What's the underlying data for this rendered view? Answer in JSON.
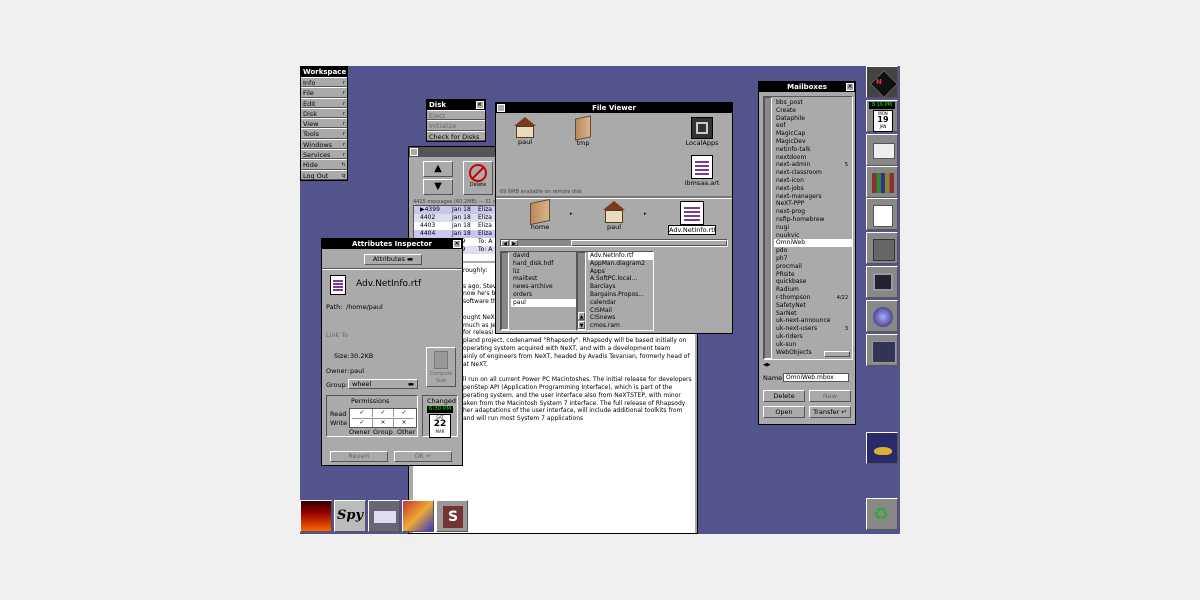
{
  "workspace_menu": {
    "title": "Workspace",
    "items": [
      {
        "label": "Info",
        "key": "r"
      },
      {
        "label": "File",
        "key": "r"
      },
      {
        "label": "Edit",
        "key": "r"
      },
      {
        "label": "Disk",
        "key": "r"
      },
      {
        "label": "View",
        "key": "r"
      },
      {
        "label": "Tools",
        "key": "r"
      },
      {
        "label": "Windows",
        "key": "r"
      },
      {
        "label": "Services",
        "key": "r"
      },
      {
        "label": "Hide",
        "key": "h"
      },
      {
        "label": "Log Out",
        "key": "q"
      }
    ]
  },
  "disk_menu": {
    "title": "Disk",
    "items": [
      {
        "label": "Eject"
      },
      {
        "label": "Initialize"
      },
      {
        "label": "Check for Disks"
      }
    ]
  },
  "file_viewer": {
    "title": "File Viewer",
    "shelf": [
      {
        "label": "paul"
      },
      {
        "label": "tmp"
      },
      {
        "label": "LocalApps"
      },
      {
        "label": "ibmsaa.art"
      }
    ],
    "status": "69.6MB available on remote disk",
    "path": [
      {
        "label": "home"
      },
      {
        "label": "paul"
      },
      {
        "label": "Adv.NetInfo.rtf"
      }
    ],
    "col1": [
      "david",
      "hard_disk.hdf",
      "liz",
      "mailtest",
      "news-archive",
      "orders",
      "paul"
    ],
    "col2": [
      "Adv.NetInfo.rtf",
      "AppMan.diagram2",
      "Apps",
      "A.SoftPC.local...",
      "Barclays",
      "Bargains.Propos...",
      "calendar",
      "CISMail",
      "CISnews",
      "cmos.ram"
    ]
  },
  "mail": {
    "delete_label": "Delete",
    "status": "4415 messages (60.2MB) — 31 d...",
    "rows": [
      {
        "num": "▶4399",
        "date": "Jan 18",
        "from": "Eliza",
        "to": "To: a"
      },
      {
        "num": "4402",
        "date": "Jan 18",
        "from": "Eliza",
        "to": ""
      },
      {
        "num": "4403",
        "date": "Jan 18",
        "from": "Eliza",
        "to": ""
      },
      {
        "num": "4404",
        "date": "Jan 18",
        "from": "Eliza",
        "to": ""
      },
      {
        "num": "",
        "date": "n 19",
        "from": "To: A",
        "to": ""
      },
      {
        "num": "",
        "date": "n 19",
        "from": "To: A",
        "to": ""
      }
    ],
    "body": [
      "roughly:",
      "",
      "s ago, Stev",
      "now he's ba",
      "software th",
      "",
      "ought NeX",
      "much as Je",
      "for releasi",
      "pland project, codenamed \"Rhapsody\". Rhapsody will be based initially on",
      "operating system acquired with NeXT, and with a development team",
      "ainly of engineers from NeXT, headed by Avadis Tevanian, formerly head of",
      "at NeXT.",
      "",
      "ll run on all current Power PC Macintoshes. The initial release for developers",
      "penStep API (Application Programming Interface), which is part of the",
      "perating system, and the user interface also from NeXTSTEP, with minor",
      "aken from the Macintosh System 7 interface. The full release of Rhapsody",
      "her adaptations of the user interface, will include additional toolkits from",
      "and will run most System 7 applications"
    ]
  },
  "inspector": {
    "title": "Attributes Inspector",
    "popup": "Attributes",
    "filename": "Adv.NetInfo.rtf",
    "path_label": "Path:",
    "path_value": "/home/paul",
    "link_label": "Link To",
    "size_label": "Size:",
    "size_value": "30.2KB",
    "owner_label": "Owner:",
    "owner_value": "paul",
    "group_label": "Group:",
    "group_value": "wheel",
    "compute_label": "Compute Size",
    "permissions_label": "Permissions",
    "read_label": "Read",
    "write_label": "Write",
    "cols": [
      "Owner",
      "Group",
      "Other"
    ],
    "changed_label": "Changed",
    "time": "6:30 PM",
    "cal_day": "SAT",
    "cal_date": "22",
    "cal_month": "MAR",
    "revert_label": "Revert",
    "ok_label": "OK"
  },
  "mailboxes": {
    "title": "Mailboxes",
    "items": [
      {
        "name": "bbs_post",
        "count": ""
      },
      {
        "name": "Create",
        "count": ""
      },
      {
        "name": "Dataphile",
        "count": ""
      },
      {
        "name": "eof",
        "count": ""
      },
      {
        "name": "MagicCap",
        "count": ""
      },
      {
        "name": "MagicDev",
        "count": ""
      },
      {
        "name": "netinfo-talk",
        "count": ""
      },
      {
        "name": "nextdoom",
        "count": ""
      },
      {
        "name": "next-admin",
        "count": "5"
      },
      {
        "name": "next-classroom",
        "count": ""
      },
      {
        "name": "next-icon",
        "count": ""
      },
      {
        "name": "next-jobs",
        "count": ""
      },
      {
        "name": "next-managers",
        "count": ""
      },
      {
        "name": "NeXT-PPP",
        "count": ""
      },
      {
        "name": "next-prog",
        "count": ""
      },
      {
        "name": "nsfip-homebrew",
        "count": ""
      },
      {
        "name": "nugi",
        "count": ""
      },
      {
        "name": "nuukvic",
        "count": ""
      },
      {
        "name": "OmniWeb",
        "count": ""
      },
      {
        "name": "pdo",
        "count": ""
      },
      {
        "name": "ph7",
        "count": ""
      },
      {
        "name": "procmail",
        "count": ""
      },
      {
        "name": "PRsite",
        "count": ""
      },
      {
        "name": "quickbase",
        "count": ""
      },
      {
        "name": "Radium",
        "count": ""
      },
      {
        "name": "r-thompson",
        "count": "4/22"
      },
      {
        "name": "SafetyNet",
        "count": ""
      },
      {
        "name": "SarNet",
        "count": ""
      },
      {
        "name": "uk-next-announce",
        "count": ""
      },
      {
        "name": "uk-next-users",
        "count": "3"
      },
      {
        "name": "uk-riders",
        "count": ""
      },
      {
        "name": "uk-sun",
        "count": ""
      },
      {
        "name": "WebObjects",
        "count": ""
      }
    ],
    "name_label": "Name:",
    "name_value": "OmniWeb.mbox",
    "delete_label": "Delete",
    "new_label": "New",
    "open_label": "Open",
    "transfer_label": "Transfer"
  },
  "dock": {
    "clock_time": "8:16 PM",
    "clock_day": "MON",
    "clock_date": "19",
    "clock_month": "JAN"
  },
  "tiles": {
    "spy_label": "Spy"
  }
}
